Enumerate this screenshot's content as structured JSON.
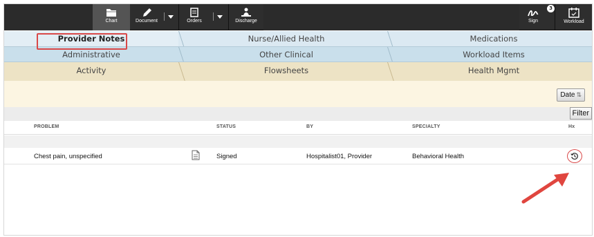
{
  "toolbar": {
    "chart_label": "Chart",
    "document_label": "Document",
    "orders_label": "Orders",
    "discharge_label": "Discharge",
    "sign_label": "Sign",
    "sign_badge": "3",
    "workload_label": "Workload",
    "icons": {
      "chart": "folder-icon",
      "document": "pen-icon",
      "orders": "clipboard-icon",
      "discharge": "person-discharge-icon",
      "sign": "signature-icon",
      "workload": "calendar-icon"
    }
  },
  "tabs": {
    "row1": [
      "Provider Notes",
      "Nurse/Allied Health",
      "Medications"
    ],
    "row2": [
      "Administrative",
      "Other Clinical",
      "Workload Items"
    ],
    "row3": [
      "Activity",
      "Flowsheets",
      "Health Mgmt"
    ],
    "active": "Provider Notes"
  },
  "controls": {
    "date_label": "Date",
    "filter_label": "Filter"
  },
  "table": {
    "columns": [
      "PROBLEM",
      "STATUS",
      "BY",
      "SPECIALTY",
      "Hx"
    ],
    "rows": [
      {
        "problem": "Chest pain, unspecified",
        "status": "Signed",
        "by": "Hospitalist01, Provider",
        "specialty": "Behavioral Health"
      }
    ]
  },
  "colors": {
    "toolbar_bg": "#2e2e2e",
    "tab_blue": "#dbe9f2",
    "tab_tan": "#ede3c5",
    "highlight_red": "#d94848"
  }
}
